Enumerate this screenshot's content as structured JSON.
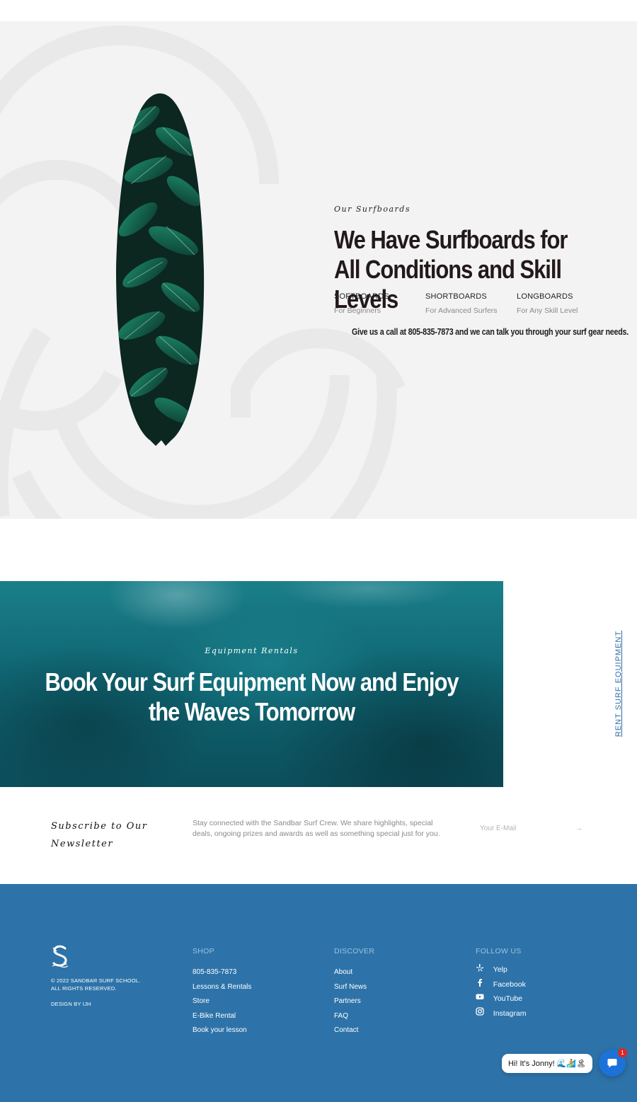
{
  "surfboards": {
    "eyebrow": "Our Surfboards",
    "title": "We Have Surfboards for All Conditions and Skill Levels",
    "categories": [
      {
        "name": "SOFTBOARDS",
        "sub": "For Beginners"
      },
      {
        "name": "SHORTBOARDS",
        "sub": "For Advanced Surfers"
      },
      {
        "name": "LONGBOARDS",
        "sub": "For Any Skill Level"
      }
    ],
    "call_text": "Give us a call at 805-835-7873 and we can talk you through your surf gear needs."
  },
  "rentals": {
    "eyebrow": "Equipment Rentals",
    "title": "Book Your Surf Equipment Now and Enjoy the Waves Tomorrow",
    "side_label": "RENT SURF EQUIPMENT"
  },
  "newsletter": {
    "title": "Subscribe to Our Newsletter",
    "text": "Stay connected with the Sandbar Surf Crew. We share highlights, special deals, ongoing prizes and awards as well as something special just for you.",
    "email_placeholder": "Your E-Mail",
    "submit_icon": "→"
  },
  "footer": {
    "copyright": "© 2022 SANDBAR SURF SCHOOL. ALL RIGHTS RESERVED.",
    "design_by": "DESIGN BY IJH",
    "shop": {
      "heading": "SHOP",
      "links": [
        "805-835-7873",
        "Lessons & Rentals",
        "Store",
        "E-Bike Rental",
        "Book your lesson"
      ]
    },
    "discover": {
      "heading": "DISCOVER",
      "links": [
        "About",
        "Surf News",
        "Partners",
        "FAQ",
        "Contact"
      ]
    },
    "follow": {
      "heading": "FOLLOW US",
      "links": [
        {
          "label": "Yelp",
          "icon": "yelp-icon"
        },
        {
          "label": "Facebook",
          "icon": "facebook-icon"
        },
        {
          "label": "YouTube",
          "icon": "youtube-icon"
        },
        {
          "label": "Instagram",
          "icon": "instagram-icon"
        }
      ]
    }
  },
  "chat": {
    "greeting": "Hi! It's Jonny! 🌊🏄🏝",
    "badge_count": "1"
  },
  "colors": {
    "footer_bg": "#2d73a9",
    "section_bg": "#f3f3f3",
    "heading_dark": "#23191a",
    "accent_blue": "#2f6ea5",
    "chat_blue": "#1c72d9"
  }
}
